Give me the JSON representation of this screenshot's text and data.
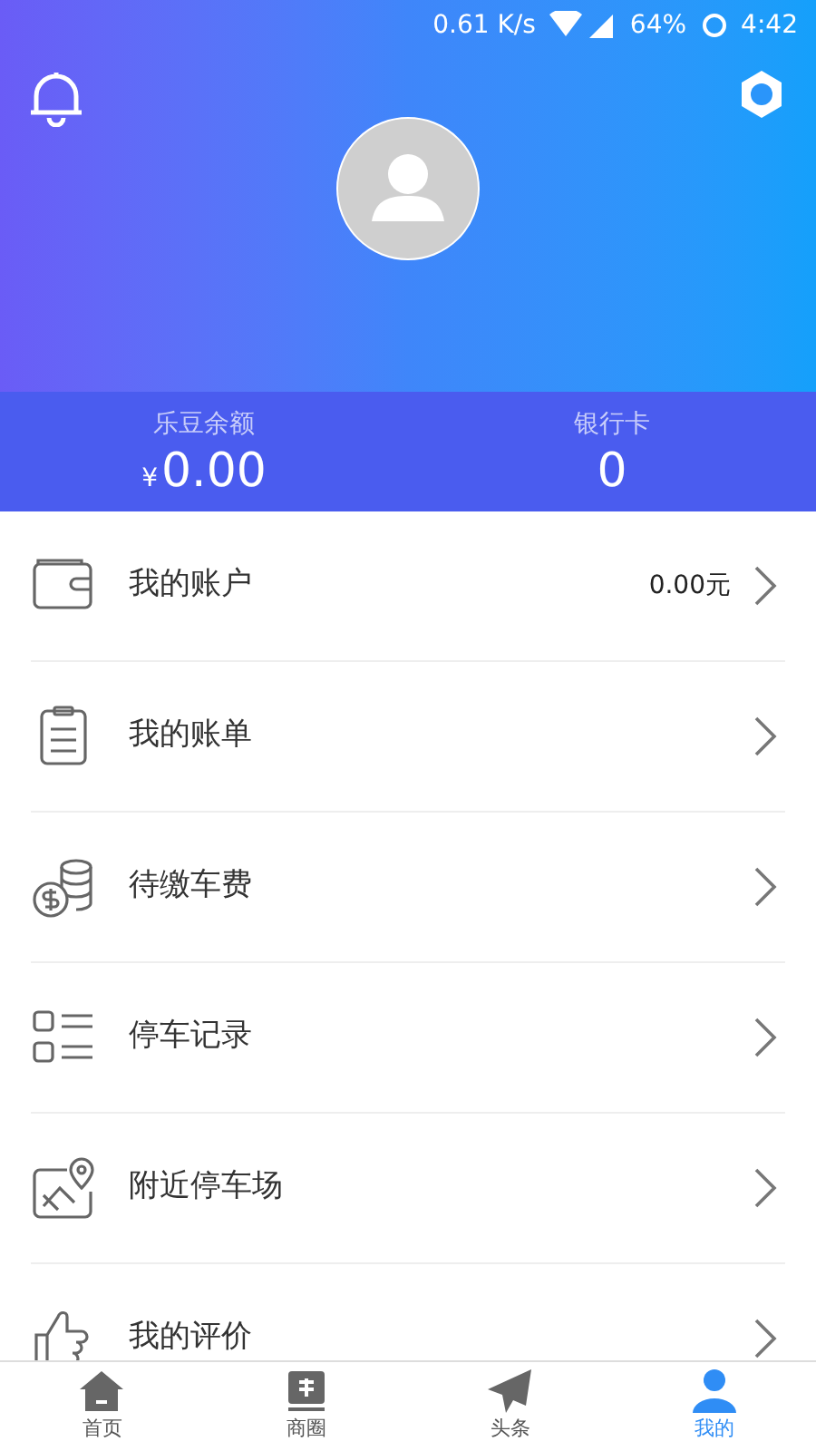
{
  "status_bar": {
    "speed": "0.61 K/s",
    "battery": "64%",
    "time": "4:42"
  },
  "balance": [
    {
      "label": "乐豆余额",
      "currency": "¥",
      "value": "0.00"
    },
    {
      "label": "银行卡",
      "value": "0"
    }
  ],
  "menu": [
    {
      "kind": "wallet",
      "label": "我的账户",
      "value": "0.00元"
    },
    {
      "kind": "bill",
      "label": "我的账单"
    },
    {
      "kind": "coins",
      "label": "待缴车费"
    },
    {
      "kind": "records",
      "label": "停车记录"
    },
    {
      "kind": "map",
      "label": "附近停车场"
    },
    {
      "kind": "thumb",
      "label": "我的评价"
    }
  ],
  "tabs": [
    {
      "kind": "home",
      "label": "首页",
      "selected": false
    },
    {
      "kind": "shop",
      "label": "商圈",
      "selected": false
    },
    {
      "kind": "plane",
      "label": "头条",
      "selected": false
    },
    {
      "kind": "user",
      "label": "我的",
      "selected": true
    }
  ]
}
